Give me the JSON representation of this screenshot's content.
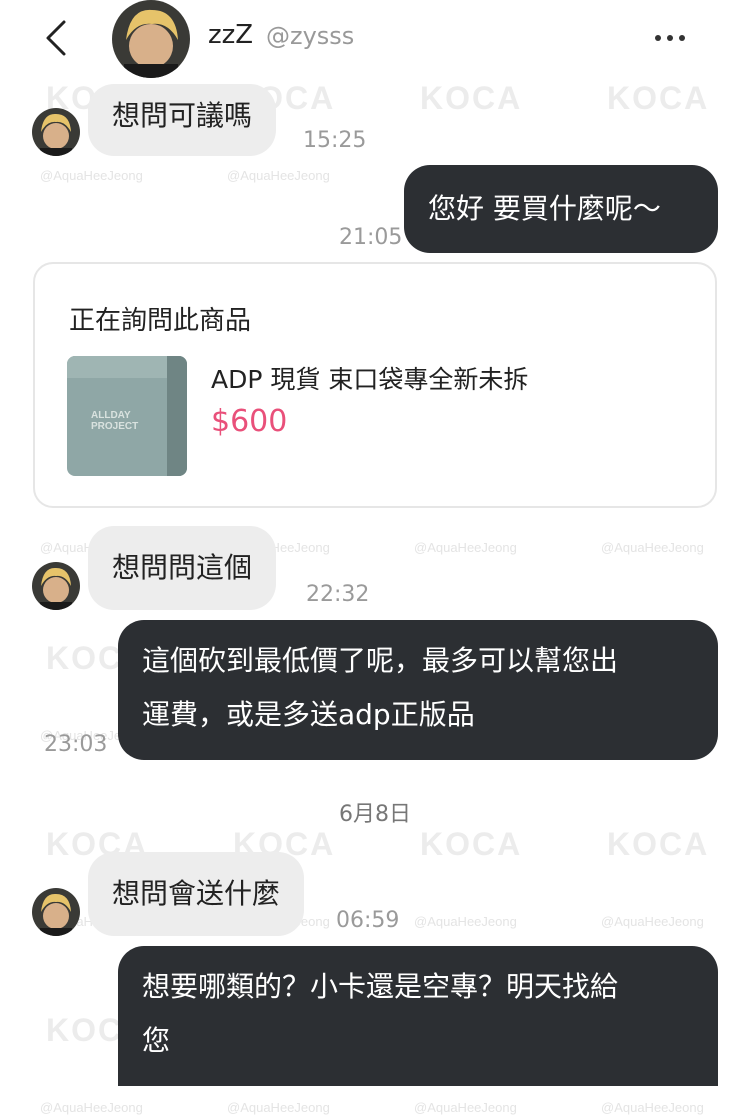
{
  "header": {
    "name": "zzZ",
    "handle": "@zysss",
    "back_icon": "chevron-left-icon",
    "more_icon": "more-horizontal-icon"
  },
  "card": {
    "title": "正在詢問此商品",
    "product_name": "ADP 現貨 束口袋專全新未拆",
    "price": "$600",
    "price_color": "#e9507a"
  },
  "messages": [
    {
      "text": "想問可議嗎",
      "time": "15:25"
    },
    {
      "text": "您好 要買什麼呢～",
      "time": "21:05"
    },
    {
      "text": "想問問這個",
      "time": "22:32"
    },
    {
      "line1": "這個砍到最低價了呢，最多可以幫您出",
      "line2": "運費，或是多送adp正版品",
      "time": "23:03"
    },
    {
      "text": "想問會送什麼",
      "time": "06:59"
    },
    {
      "line1": "想要哪類的？小卡還是空專？明天找給",
      "line2": "您"
    }
  ],
  "date_separator": "6月8日",
  "watermark": {
    "brand": "KOCA",
    "handle": "@AquaHeeJeong"
  }
}
